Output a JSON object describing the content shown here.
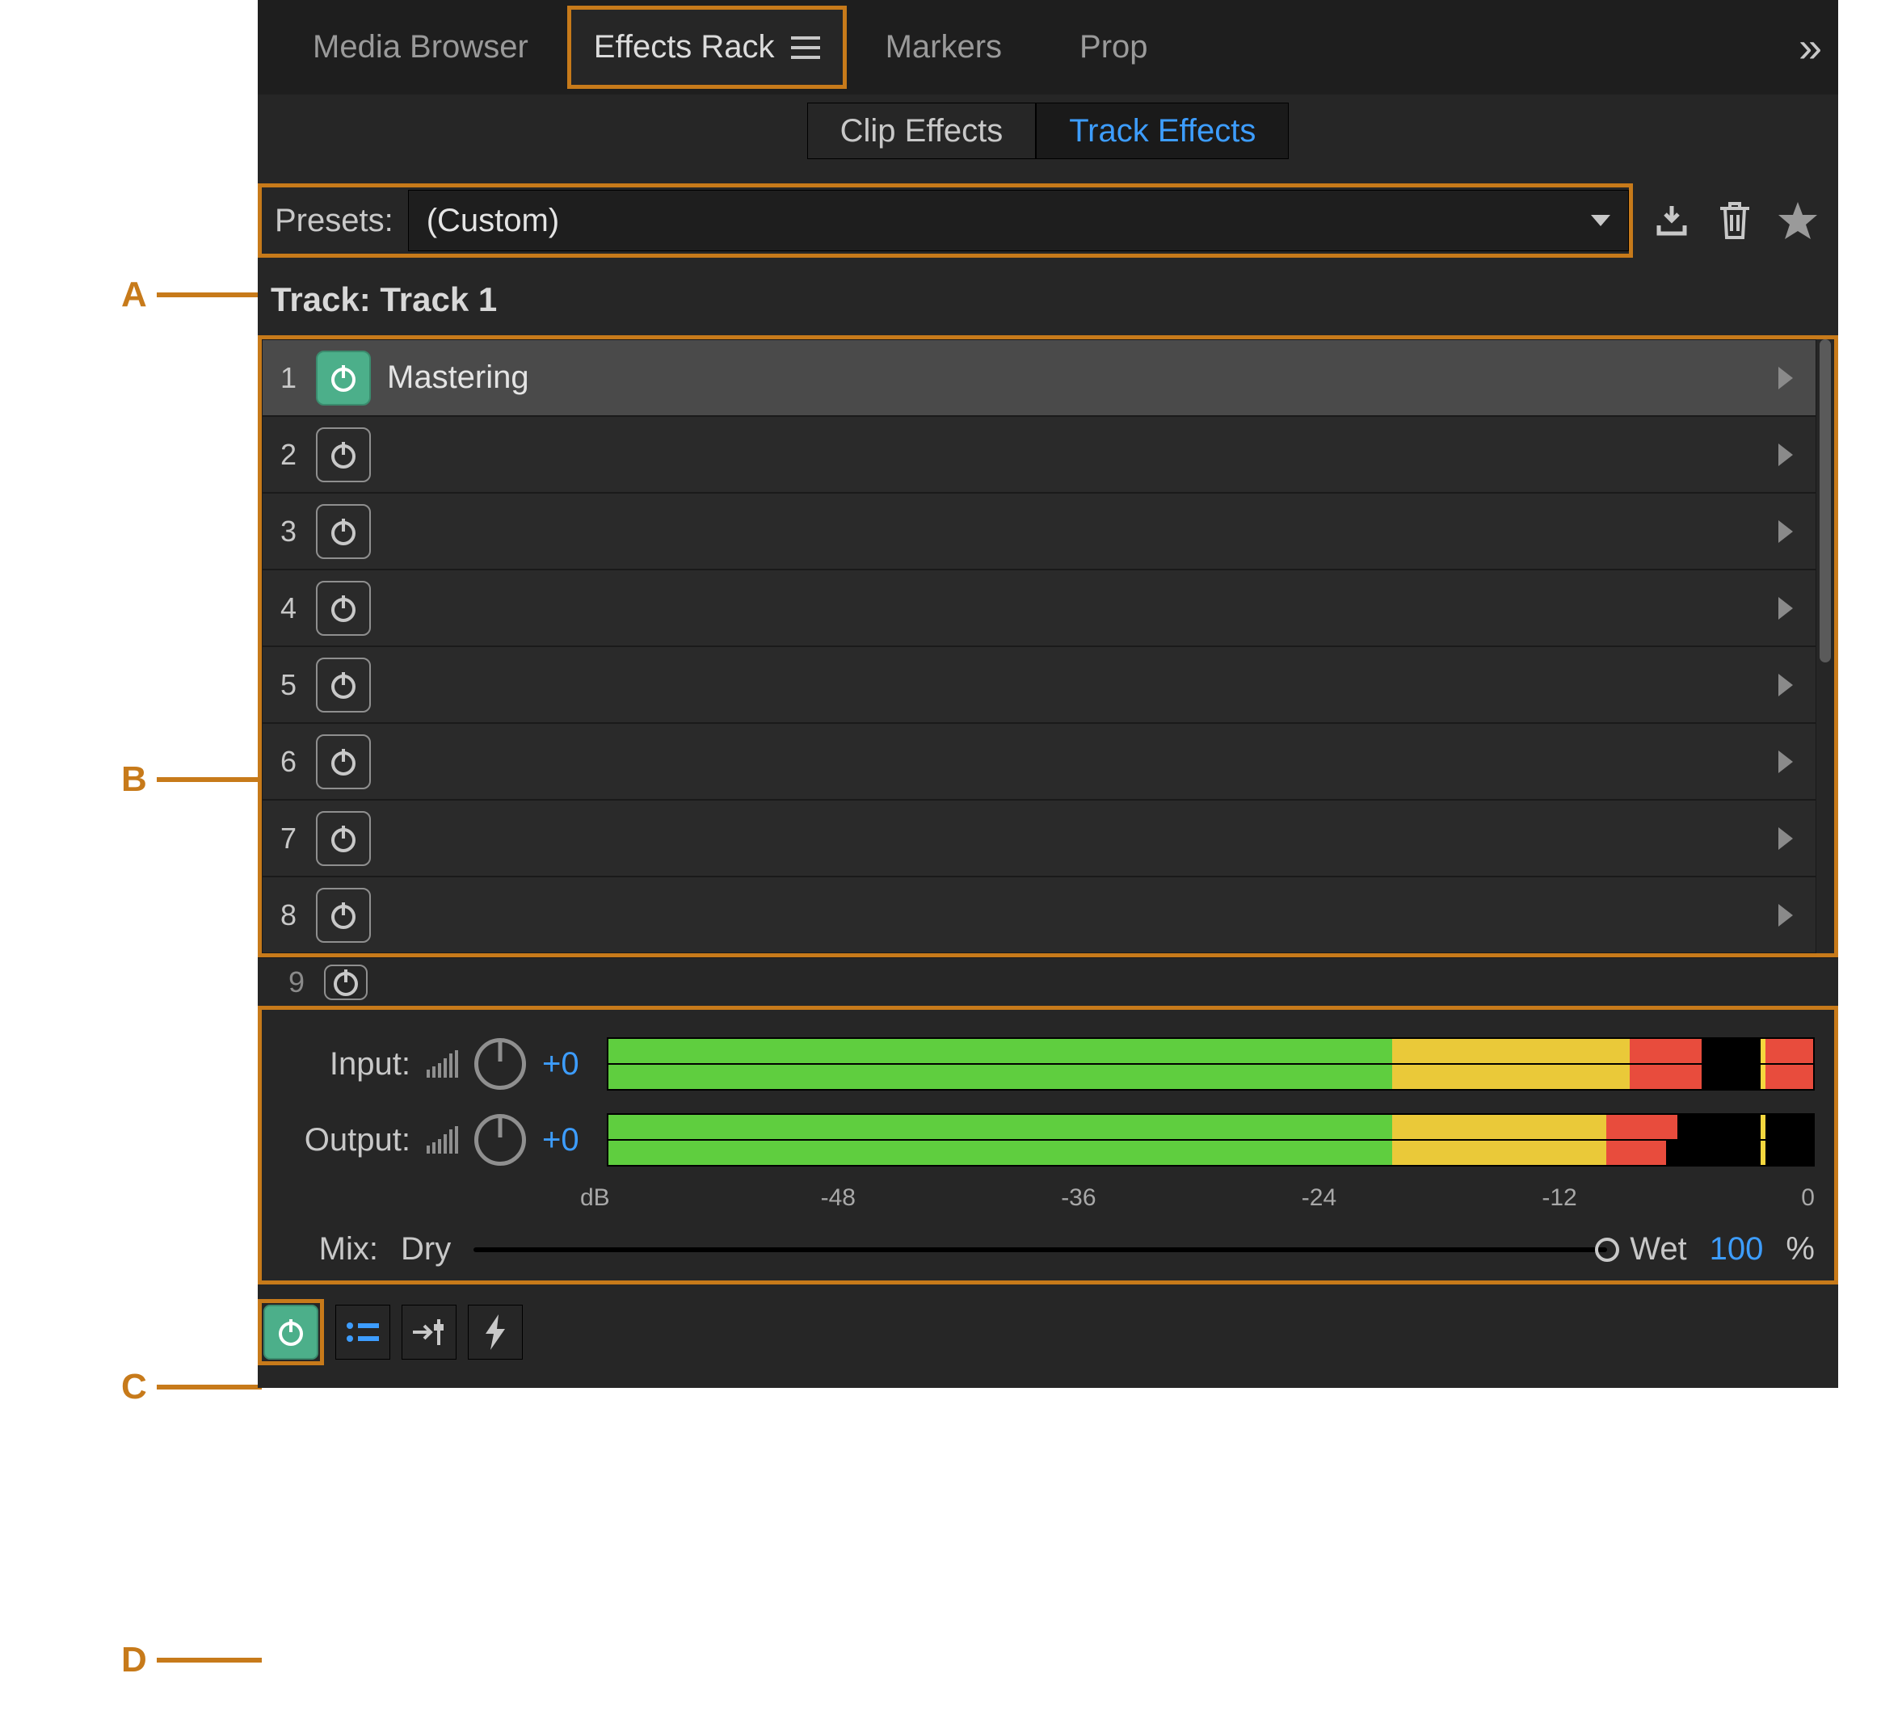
{
  "callouts": {
    "A": "A",
    "B": "B",
    "C": "C",
    "D": "D"
  },
  "tabs": {
    "media_browser": "Media Browser",
    "effects_rack": "Effects Rack",
    "markers": "Markers",
    "properties": "Prop",
    "overflow": "»"
  },
  "subtabs": {
    "clip": "Clip Effects",
    "track": "Track Effects"
  },
  "presets": {
    "label": "Presets:",
    "value": "(Custom)"
  },
  "track_label": "Track: Track 1",
  "slots": [
    {
      "n": "1",
      "on": true,
      "name": "Mastering"
    },
    {
      "n": "2",
      "on": false,
      "name": ""
    },
    {
      "n": "3",
      "on": false,
      "name": ""
    },
    {
      "n": "4",
      "on": false,
      "name": ""
    },
    {
      "n": "5",
      "on": false,
      "name": ""
    },
    {
      "n": "6",
      "on": false,
      "name": ""
    },
    {
      "n": "7",
      "on": false,
      "name": ""
    },
    {
      "n": "8",
      "on": false,
      "name": ""
    }
  ],
  "slot_peek": "9",
  "meters": {
    "input_label": "Input:",
    "output_label": "Output:",
    "input_value": "+0",
    "output_value": "+0",
    "scale": [
      "dB",
      "-48",
      "-36",
      "-24",
      "-12",
      "0"
    ]
  },
  "mix": {
    "label": "Mix:",
    "dry": "Dry",
    "wet": "Wet",
    "value": "100",
    "unit": "%"
  }
}
